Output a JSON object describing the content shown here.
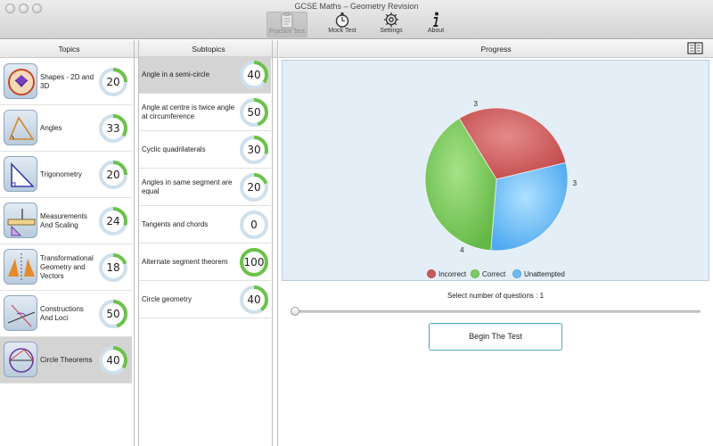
{
  "window": {
    "title": "GCSE Maths – Geometry Revision"
  },
  "toolbar": [
    {
      "label": "Practice Test",
      "icon": "clipboard-icon",
      "active": true
    },
    {
      "label": "Mock Test",
      "icon": "stopwatch-icon",
      "active": false
    },
    {
      "label": "Settings",
      "icon": "gear-icon",
      "active": false
    },
    {
      "label": "About",
      "icon": "info-icon",
      "active": false
    }
  ],
  "headers": {
    "topics": "Topics",
    "subtopics": "Subtopics",
    "progress": "Progress"
  },
  "topics": [
    {
      "label": "Shapes - 2D and 3D",
      "count": "20",
      "progress": 0.25
    },
    {
      "label": "Angles",
      "count": "33",
      "progress": 0.35
    },
    {
      "label": "Trigonometry",
      "count": "20",
      "progress": 0.25
    },
    {
      "label": "Measurements And Scaling",
      "count": "24",
      "progress": 0.3
    },
    {
      "label": "Transformational Geometry and Vectors",
      "count": "18",
      "progress": 0.2
    },
    {
      "label": "Constructions And Loci",
      "count": "50",
      "progress": 0.45
    },
    {
      "label": "Circle Theorems",
      "count": "40",
      "progress": 0.35,
      "selected": true
    }
  ],
  "subtopics": [
    {
      "label": "Angle in a semi-circle",
      "count": "40",
      "progress": 0.35,
      "selected": true
    },
    {
      "label": "Angle at centre is twice angle at circumference",
      "count": "50",
      "progress": 0.45
    },
    {
      "label": "Cyclic quadrilaterals",
      "count": "30",
      "progress": 0.3
    },
    {
      "label": "Angles in same segment are equal",
      "count": "20",
      "progress": 0.2
    },
    {
      "label": "Tangents and chords",
      "count": "0",
      "progress": 0
    },
    {
      "label": "Alternate segment theorem",
      "count": "100",
      "progress": 1.0
    },
    {
      "label": "Circle geometry",
      "count": "40",
      "progress": 0.4
    }
  ],
  "chart_data": {
    "type": "pie",
    "categories": [
      "Incorrect",
      "Correct",
      "Unattempted"
    ],
    "values": [
      3,
      4,
      3
    ],
    "colors": [
      "#cc5a5a",
      "#7ecb5e",
      "#6cbcf5"
    ],
    "legend_position": "bottom"
  },
  "select_label": "Select number of questions : 1",
  "slider": {
    "value": 1
  },
  "begin_button": "Begin The Test",
  "colors": {
    "ring_fill": "#6cc24a",
    "ring_track": "#cfe0ec",
    "accent": "#4fa3c6"
  }
}
